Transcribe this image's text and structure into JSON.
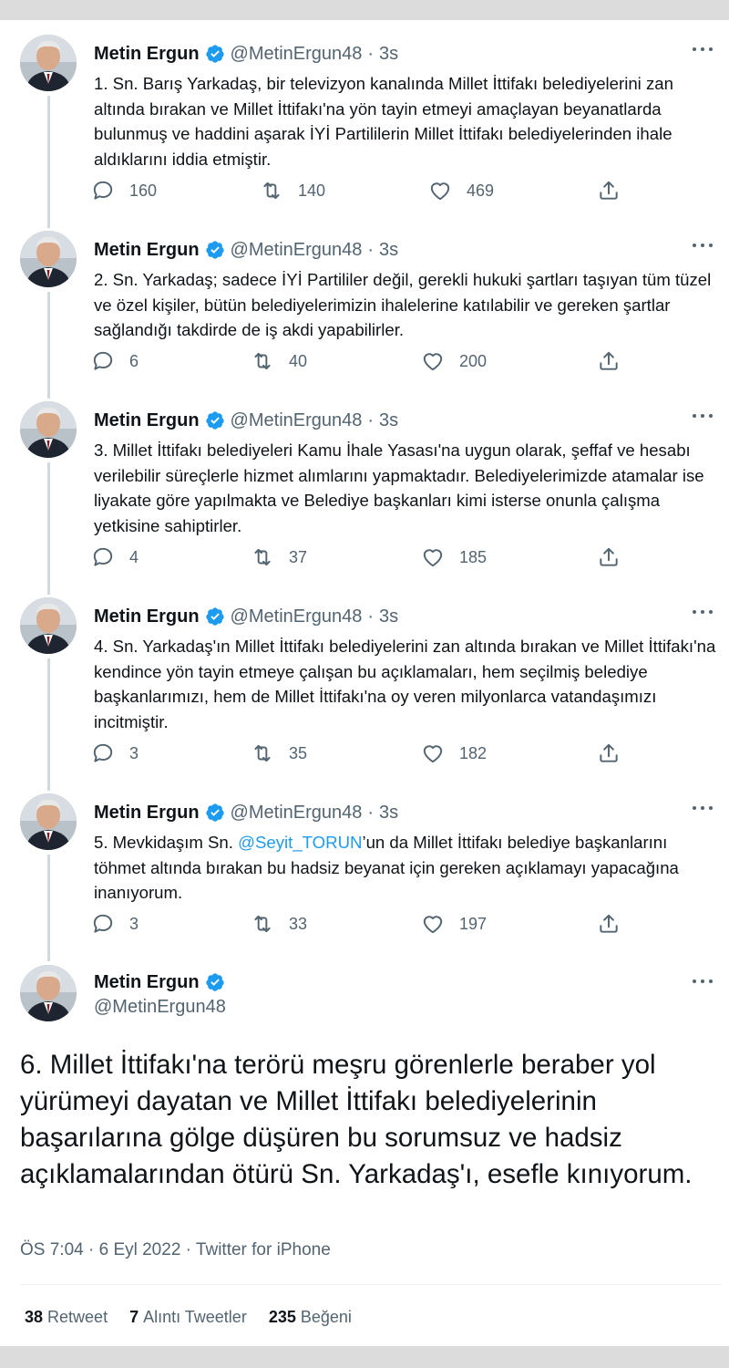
{
  "author": {
    "name": "Metin Ergun",
    "handle": "@MetinErgun48"
  },
  "colors": {
    "link": "#1d9bf0",
    "verified": "#1d9bf0",
    "secondary_text": "#536471"
  },
  "tweets": [
    {
      "time": "3s",
      "text": "1. Sn. Barış Yarkadaş, bir televizyon kanalında Millet İttifakı belediyelerini zan altında bırakan ve Millet İttifakı'na yön tayin etmeyi amaçlayan beyanatlarda bulunmuş ve haddini aşarak İYİ Partililerin Millet İttifakı belediyelerinden ihale aldıklarını iddia etmiştir.",
      "replies": "160",
      "retweets": "140",
      "likes": "469"
    },
    {
      "time": "3s",
      "text": "2. Sn. Yarkadaş; sadece İYİ Partililer değil, gerekli hukuki şartları taşıyan tüm tüzel ve özel kişiler, bütün belediyelerimizin ihalelerine katılabilir ve gereken şartlar sağlandığı takdirde de iş akdi yapabilirler.",
      "replies": "6",
      "retweets": "40",
      "likes": "200"
    },
    {
      "time": "3s",
      "text": "3. Millet İttifakı belediyeleri Kamu İhale Yasası'na uygun olarak, şeffaf ve hesabı verilebilir süreçlerle hizmet alımlarını yapmaktadır. Belediyelerimizde atamalar ise liyakate göre yapılmakta ve Belediye başkanları kimi isterse onunla çalışma yetkisine sahiptirler.",
      "replies": "4",
      "retweets": "37",
      "likes": "185"
    },
    {
      "time": "3s",
      "text": "4. Sn. Yarkadaş'ın Millet İttifakı belediyelerini zan altında bırakan ve Millet İttifakı'na kendince yön tayin etmeye çalışan bu açıklamaları, hem seçilmiş belediye başkanlarımızı, hem de Millet İttifakı'na oy veren milyonlarca vatandaşımızı incitmiştir.",
      "replies": "3",
      "retweets": "35",
      "likes": "182"
    },
    {
      "time": "3s",
      "text_before": "5. Mevkidaşım Sn. ",
      "mention": "@Seyit_TORUN",
      "text_after": "’un da Millet İttifakı belediye başkanlarını töhmet altında bırakan bu hadsiz beyanat için gereken açıklamayı yapacağına inanıyorum.",
      "replies": "3",
      "retweets": "33",
      "likes": "197"
    }
  ],
  "main_tweet": {
    "text": "6. Millet İttifakı'na terörü meşru görenlerle beraber yol yürümeyi dayatan ve Millet İttifakı belediyelerinin başarılarına gölge düşüren bu sorumsuz ve hadsiz açıklamalarından ötürü Sn. Yarkadaş'ı, esefle kınıyorum.",
    "meta": "ÖS 7:04 · 6 Eyl 2022 · Twitter for iPhone",
    "retweet_count": "38",
    "retweet_label": "Retweet",
    "quote_count": "7",
    "quote_label": "Alıntı Tweetler",
    "like_count": "235",
    "like_label": "Beğeni"
  },
  "separator_dot": "·",
  "icons": [
    "verified-badge-icon",
    "more-options-icon",
    "reply-icon",
    "retweet-icon",
    "like-icon",
    "share-icon"
  ]
}
